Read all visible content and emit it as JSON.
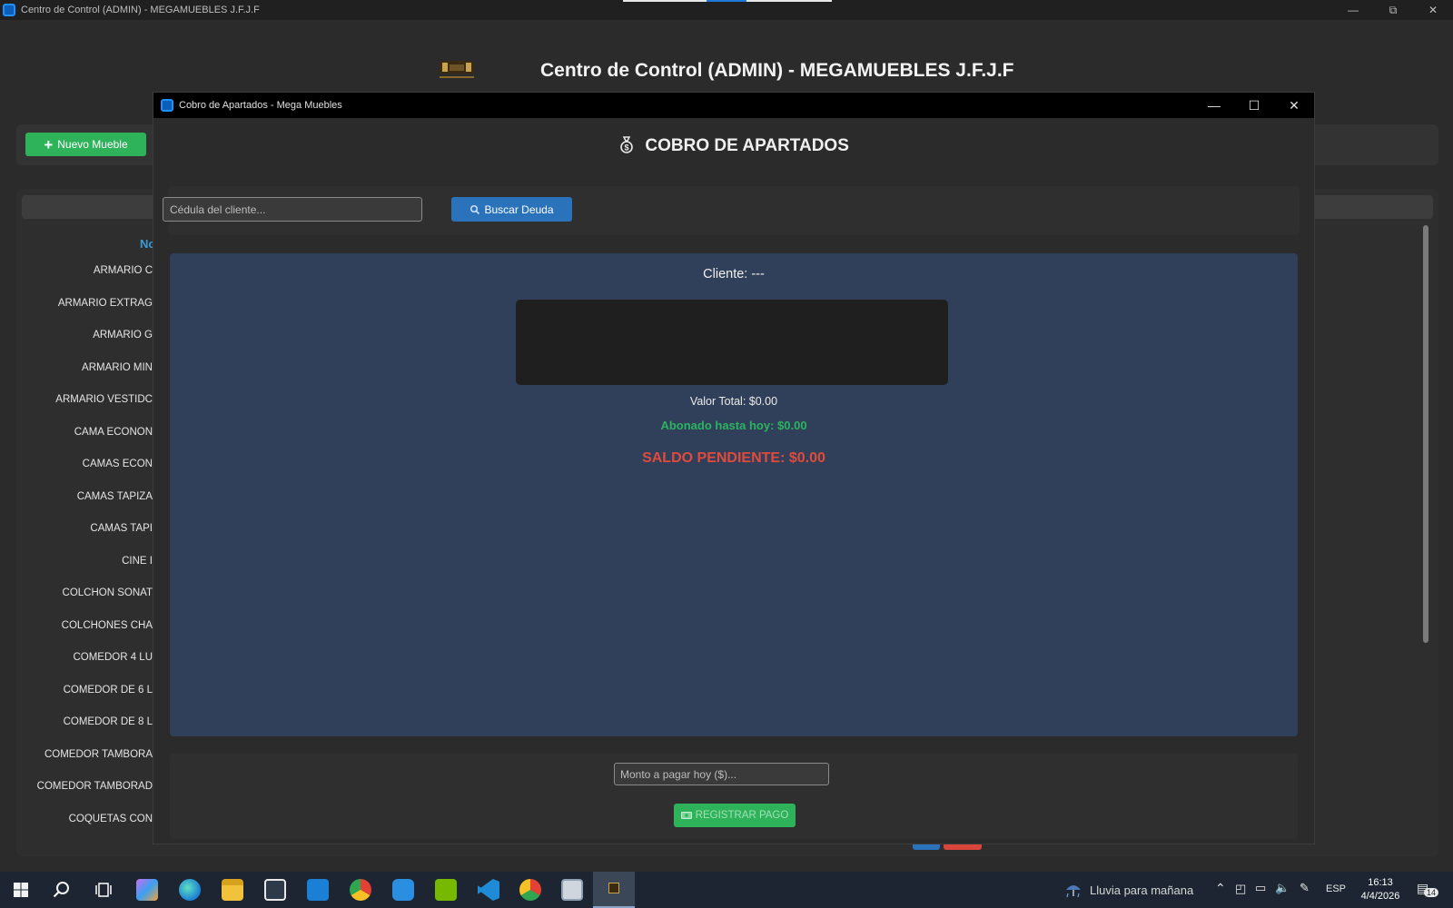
{
  "main_window": {
    "title": "Centro de Control (ADMIN) - MEGAMUEBLES J.F.J.F",
    "header_title": "Centro de Control (ADMIN) - MEGAMUEBLES J.F.J.F",
    "new_button_label": "Nuevo Mueble",
    "list_column_title": "No",
    "products": [
      "ARMARIO C",
      "ARMARIO EXTRAG",
      "ARMARIO G",
      "ARMARIO MIN",
      "ARMARIO VESTIDC",
      "CAMA ECONON",
      "CAMAS ECON",
      "CAMAS TAPIZA",
      "CAMAS TAPI",
      "CINE I",
      "COLCHON SONAT",
      "COLCHONES CHA",
      "COMEDOR 4 LU",
      "COMEDOR DE 6 L",
      "COMEDOR DE 8 L",
      "COMEDOR TAMBORA",
      "COMEDOR TAMBORAD",
      "COQUETAS CON"
    ]
  },
  "dialog": {
    "title": "Cobro de Apartados - Mega Muebles",
    "heading": "COBRO DE APARTADOS",
    "id_placeholder": "Cédula del cliente...",
    "search_button": "Buscar Deuda",
    "client_label": "Cliente: ---",
    "total_value": "Valor Total: $0.00",
    "paid_value": "Abonado hasta hoy: $0.00",
    "balance_value": "SALDO PENDIENTE: $0.00",
    "amount_placeholder": "Monto a pagar hoy ($)...",
    "register_button": "REGISTRAR PAGO"
  },
  "taskbar": {
    "weather_text": "Lluvia para mañana",
    "language": "ESP",
    "time": "16:13",
    "date": "4/4/2026",
    "notification_count": "14"
  },
  "colors": {
    "success_green": "#2fb35a",
    "primary_blue": "#2a72ba",
    "danger_red": "#e04a3b",
    "info_panel": "#31405a"
  }
}
